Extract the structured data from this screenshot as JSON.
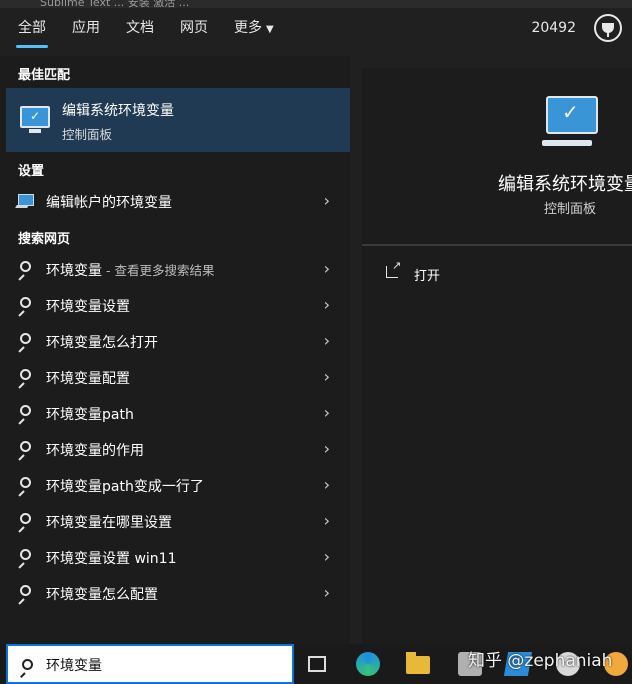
{
  "window_title_fragment": "Sublime Text ... 安装 激活 ...",
  "tabs": [
    {
      "label": "全部"
    },
    {
      "label": "应用"
    },
    {
      "label": "文档"
    },
    {
      "label": "网页"
    },
    {
      "label": "更多"
    }
  ],
  "points": "20492",
  "sections": {
    "best_match": "最佳匹配",
    "settings": "设置",
    "search_web": "搜索网页"
  },
  "best_match": {
    "title": "编辑系统环境变量",
    "subtitle": "控制面板"
  },
  "settings_items": [
    {
      "label": "编辑帐户的环境变量"
    }
  ],
  "web_items": [
    {
      "bold": "环境变量",
      "rest": " - 查看更多搜索结果"
    },
    {
      "bold": "",
      "rest": "环境变量设置"
    },
    {
      "bold": "",
      "rest": "环境变量怎么打开"
    },
    {
      "bold": "",
      "rest": "环境变量配置"
    },
    {
      "bold": "",
      "rest": "环境变量path"
    },
    {
      "bold": "",
      "rest": "环境变量的作用"
    },
    {
      "bold": "",
      "rest": "环境变量path变成一行了"
    },
    {
      "bold": "",
      "rest": "环境变量在哪里设置"
    },
    {
      "bold": "",
      "rest": "环境变量设置 win11"
    },
    {
      "bold": "",
      "rest": "环境变量怎么配置"
    }
  ],
  "preview": {
    "title": "编辑系统环境变量",
    "subtitle": "控制面板",
    "open_label": "打开"
  },
  "search": {
    "query": "环境变量"
  },
  "watermark": "知乎 @zephaniah",
  "colors": {
    "accent": "#4cc2ff",
    "selected_bg": "#1f3a52",
    "panel_bg": "#1c1c1c"
  }
}
